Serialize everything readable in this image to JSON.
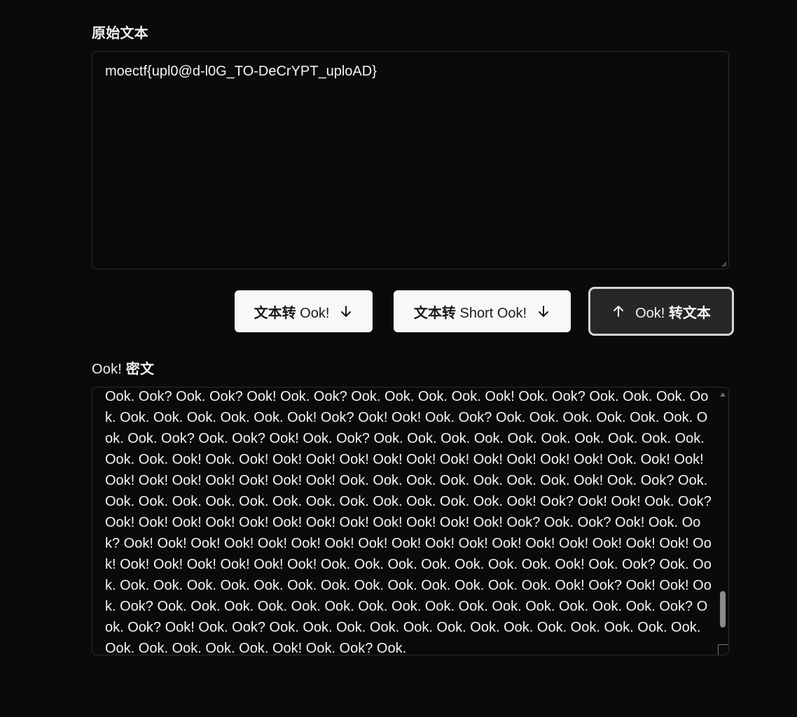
{
  "input_section": {
    "label": "原始文本",
    "value": "moectf{upl0@d-l0G_TO-DeCrYPT_uploAD}"
  },
  "buttons": {
    "to_ook_zh": "文本转",
    "to_ook_en": " Ook! ",
    "to_short_ook_zh": "文本转",
    "to_short_ook_en": " Short Ook! ",
    "from_ook_en": "Ook! ",
    "from_ook_zh": "转文本",
    "down_arrow_icon": "arrow-down-icon",
    "up_arrow_icon": "arrow-up-icon"
  },
  "output_section": {
    "label_en": "Ook! ",
    "label_zh": "密文",
    "value": "Ook. Ook? Ook. Ook? Ook! Ook. Ook? Ook. Ook. Ook. Ook. Ook! Ook. Ook? Ook. Ook. Ook. Ook. Ook. Ook. Ook. Ook. Ook. Ook! Ook? Ook! Ook! Ook. Ook? Ook. Ook. Ook. Ook. Ook. Ook. Ook. Ook. Ook? Ook. Ook? Ook! Ook. Ook? Ook. Ook. Ook. Ook. Ook. Ook. Ook. Ook. Ook. Ook. Ook. Ook. Ook! Ook. Ook! Ook! Ook! Ook! Ook! Ook! Ook! Ook! Ook! Ook! Ook! Ook. Ook! Ook! Ook! Ook! Ook! Ook! Ook! Ook! Ook! Ook. Ook. Ook. Ook. Ook. Ook. Ook. Ook! Ook. Ook? Ook. Ook. Ook. Ook. Ook. Ook. Ook. Ook. Ook. Ook. Ook. Ook. Ook. Ook! Ook? Ook! Ook! Ook. Ook? Ook! Ook! Ook! Ook! Ook! Ook! Ook! Ook! Ook! Ook! Ook! Ook! Ook? Ook. Ook? Ook! Ook. Ook? Ook! Ook! Ook! Ook! Ook! Ook! Ook! Ook! Ook! Ook! Ook! Ook! Ook! Ook! Ook! Ook! Ook! Ook! Ook! Ook! Ook! Ook! Ook! Ook! Ook. Ook. Ook. Ook. Ook. Ook. Ook. Ook! Ook. Ook? Ook. Ook. Ook. Ook. Ook. Ook. Ook. Ook. Ook. Ook. Ook. Ook. Ook. Ook. Ook. Ook! Ook? Ook! Ook! Ook. Ook? Ook. Ook. Ook. Ook. Ook. Ook. Ook. Ook. Ook. Ook. Ook. Ook. Ook. Ook. Ook. Ook? Ook. Ook? Ook! Ook. Ook? Ook. Ook. Ook. Ook. Ook. Ook. Ook. Ook. Ook. Ook. Ook. Ook. Ook. Ook. Ook. Ook. Ook. Ook. Ook! Ook. Ook? Ook."
  },
  "colors": {
    "background": "#0a0a0c",
    "text": "#f2f2f2",
    "button_light_bg": "#f8f8f8",
    "button_dark_bg": "#27272a",
    "border": "#2a2a2e"
  }
}
